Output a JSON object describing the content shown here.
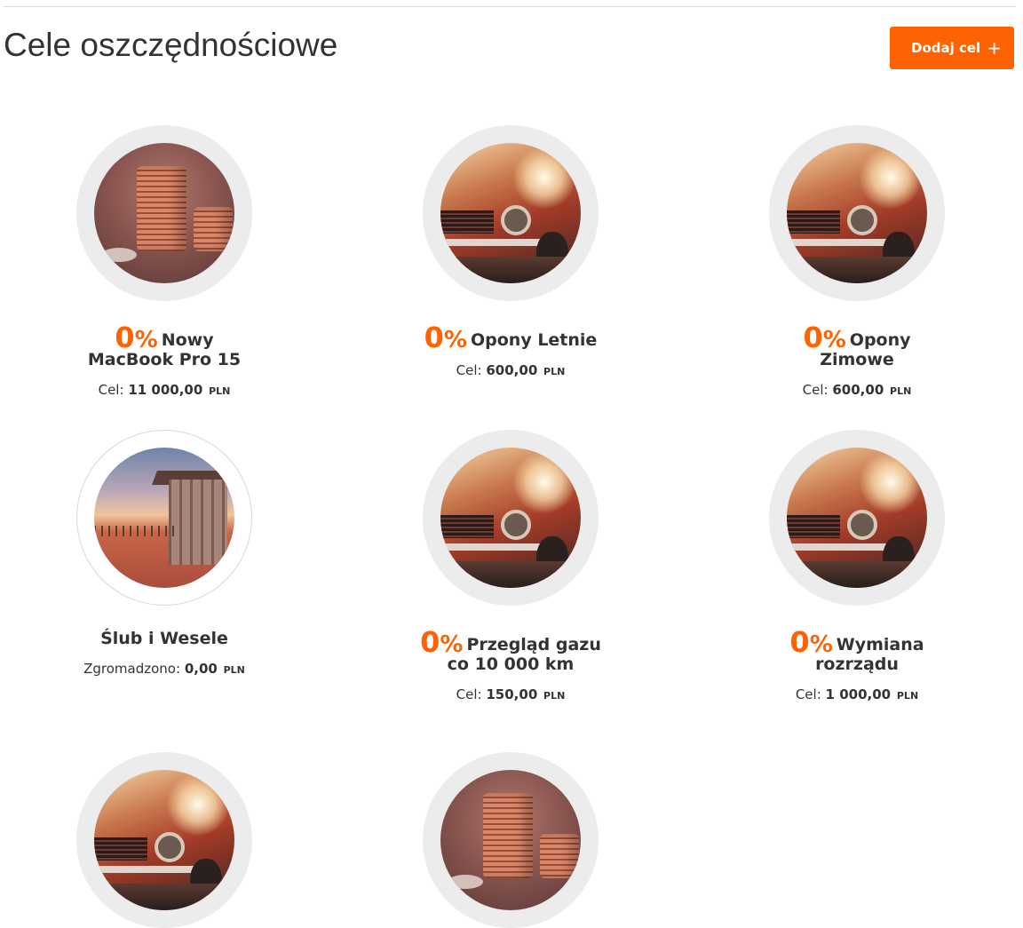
{
  "page": {
    "title": "Cele oszczędnościowe"
  },
  "actions": {
    "add_label": "Dodaj cel",
    "add_icon": "plus-icon",
    "add_icon_glyph": "+"
  },
  "accent_color": "#ff6200",
  "goals": [
    {
      "image": "coins",
      "percent": "0",
      "percent_sign": "%",
      "name": "Nowy MacBook Pro 15",
      "meta_label": "Cel:",
      "amount": "11 000,00",
      "currency": "PLN"
    },
    {
      "image": "car",
      "percent": "0",
      "percent_sign": "%",
      "name": "Opony Letnie",
      "meta_label": "Cel:",
      "amount": "600,00",
      "currency": "PLN"
    },
    {
      "image": "car",
      "percent": "0",
      "percent_sign": "%",
      "name": "Opony Zimowe",
      "meta_label": "Cel:",
      "amount": "600,00",
      "currency": "PLN"
    },
    {
      "image": "house",
      "percent": null,
      "name": "Ślub i Wesele",
      "meta_label": "Zgromadzono:",
      "amount": "0,00",
      "currency": "PLN"
    },
    {
      "image": "car",
      "percent": "0",
      "percent_sign": "%",
      "name": "Przegląd gazu co 10 000 km",
      "meta_label": "Cel:",
      "amount": "150,00",
      "currency": "PLN"
    },
    {
      "image": "car",
      "percent": "0",
      "percent_sign": "%",
      "name": "Wymiana rozrządu",
      "meta_label": "Cel:",
      "amount": "1 000,00",
      "currency": "PLN"
    },
    {
      "image": "car"
    },
    {
      "image": "coins"
    }
  ]
}
